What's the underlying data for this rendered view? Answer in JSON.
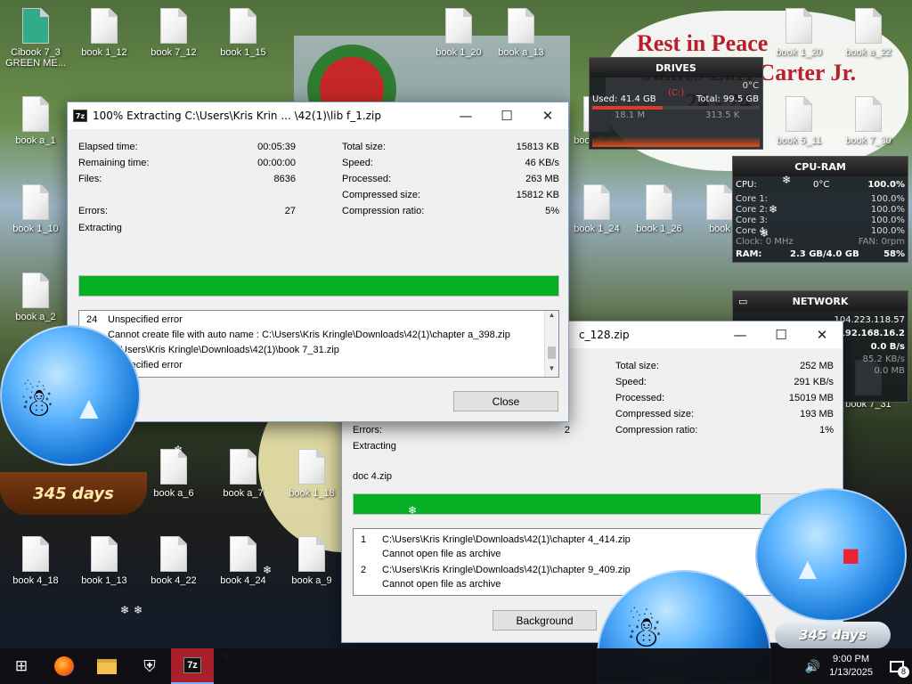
{
  "desktop": {
    "icons": [
      {
        "label": "Cibook 7_3 GREEN ME..."
      },
      {
        "label": "book 1_12"
      },
      {
        "label": "book 7_12"
      },
      {
        "label": "book 1_15"
      },
      {
        "label": "book 1_20"
      },
      {
        "label": "book a_13"
      },
      {
        "label": "book 1_20"
      },
      {
        "label": "book a_22"
      },
      {
        "label": "book a_1"
      },
      {
        "label": "book 7_23"
      },
      {
        "label": "book 5_11"
      },
      {
        "label": "book 7_30"
      },
      {
        "label": "book 1_10"
      },
      {
        "label": "book 1_24"
      },
      {
        "label": "book 1_26"
      },
      {
        "label": "book"
      },
      {
        "label": "book a_2"
      },
      {
        "label": "book 7_31"
      },
      {
        "label": "book a_6"
      },
      {
        "label": "book a_7"
      },
      {
        "label": "book 1_18"
      },
      {
        "label": "book 4_18"
      },
      {
        "label": "book 1_13"
      },
      {
        "label": "book 4_22"
      },
      {
        "label": "book 4_24"
      },
      {
        "label": "book a_9"
      }
    ],
    "wallpaper_sign": [
      "Rest in Peace",
      "James Earl Carter Jr.",
      "24 - 24"
    ],
    "snow_globe_days": "345 days"
  },
  "drives": {
    "title": "DRIVES",
    "temp": "0°C",
    "drive": "(C:)",
    "used": "Used: 41.4 GB",
    "total": "Total: 99.5 GB",
    "read": "18.1 M",
    "write": "313.5 K"
  },
  "cpu_ram": {
    "title": "CPU-RAM",
    "cpu": "CPU:",
    "temp": "0°C",
    "cpu_pct": "100.0%",
    "cores": [
      {
        "label": "Core 1:",
        "pct": "100.0%"
      },
      {
        "label": "Core 2:",
        "pct": "100.0%"
      },
      {
        "label": "Core 3:",
        "pct": "100.0%"
      },
      {
        "label": "Core 4:",
        "pct": "100.0%"
      }
    ],
    "clock": "Clock: 0 MHz",
    "fan": "FAN: 0rpm",
    "ram_label": "RAM:",
    "ram": "2.3 GB/4.0 GB",
    "ram_pct": "58%"
  },
  "network": {
    "title": "NETWORK",
    "external_ip": "104.223.118.57",
    "internal_ip": "192.168.16.2",
    "down": "0.0 B/s",
    "up1": "85.2 KB/s",
    "up2": "0.0 MB"
  },
  "main_dialog": {
    "title": "100% Extracting C:\\Users\\Kris Krin ... \\42(1)\\lib f_1.zip",
    "elapsed_label": "Elapsed time:",
    "elapsed": "00:05:39",
    "remaining_label": "Remaining time:",
    "remaining": "00:00:00",
    "files_label": "Files:",
    "files": "8636",
    "errors_label": "Errors:",
    "errors": "27",
    "status": "Extracting",
    "total_label": "Total size:",
    "total": "15813 KB",
    "speed_label": "Speed:",
    "speed": "46 KB/s",
    "processed_label": "Processed:",
    "processed": "263 MB",
    "compressed_label": "Compressed size:",
    "compressed": "15812 KB",
    "ratio_label": "Compression ratio:",
    "ratio": "5%",
    "progress_pct": 100,
    "log": [
      {
        "num": "24",
        "text": "Unspecified error"
      },
      {
        "num": "",
        "text": "Cannot create file with auto name : C:\\Users\\Kris Kringle\\Downloads\\42(1)\\chapter a_398.zip"
      },
      {
        "num": "",
        "text": "C:\\Users\\Kris Kringle\\Downloads\\42(1)\\book 7_31.zip"
      },
      {
        "num": "",
        "text": "Unspecified error"
      }
    ],
    "close_label": "Close"
  },
  "second_dialog": {
    "title_tail": "c_128.zip",
    "total_label": "Total size:",
    "total": "252 MB",
    "speed_label": "Speed:",
    "speed": "291 KB/s",
    "processed_label": "Processed:",
    "processed": "15019 MB",
    "compressed_label": "Compressed size:",
    "compressed": "193 MB",
    "ratio_label": "Compression ratio:",
    "ratio": "1%",
    "errors_label": "Errors:",
    "errors": "2",
    "status": "Extracting",
    "current_file": "doc 4.zip",
    "progress_pct": 85,
    "log": [
      {
        "num": "1",
        "path": "C:\\Users\\Kris Kringle\\Downloads\\42(1)\\chapter 4_414.zip",
        "msg": "Cannot open file as archive"
      },
      {
        "num": "2",
        "path": "C:\\Users\\Kris Kringle\\Downloads\\42(1)\\chapter 9_409.zip",
        "msg": "Cannot open file as archive"
      }
    ],
    "background_label": "Background"
  },
  "taskbar": {
    "time": "9:00 PM",
    "date": "1/13/2025",
    "notif_count": "8",
    "app_7z": "7z"
  }
}
